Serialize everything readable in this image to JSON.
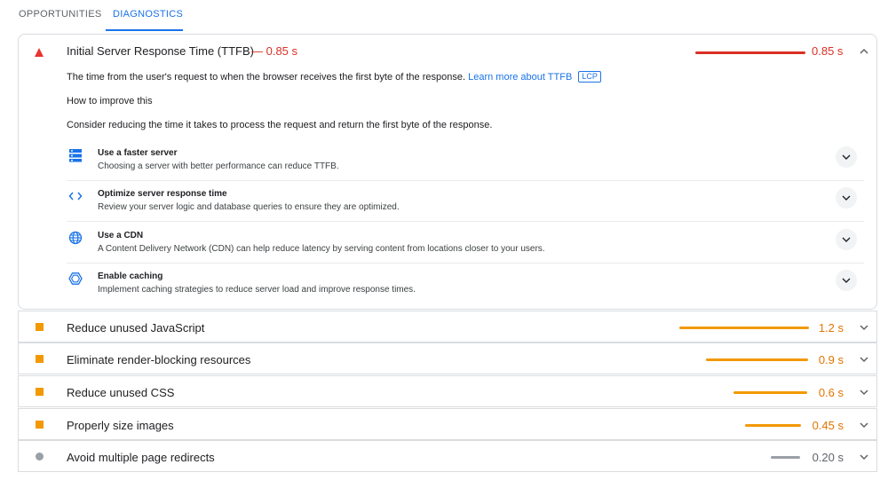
{
  "tabs": [
    {
      "label": "OPPORTUNITIES",
      "active": false
    },
    {
      "label": "DIAGNOSTICS",
      "active": true
    }
  ],
  "expanded": {
    "title": "Initial Server Response Time (TTFB)",
    "metric": "— 0.85 s",
    "value": "0.85 s",
    "description": "The time from the user's request to when the browser receives the first byte of the response.",
    "learn_more": "Learn more about TTFB",
    "badge": "LCP",
    "how_title": "How to improve this",
    "consider": "Consider reducing the time it takes to process the request and return the first byte of the response.",
    "suggestions": [
      {
        "icon": "server-icon",
        "title": "Use a faster server",
        "text": "Choosing a server with better performance can reduce TTFB."
      },
      {
        "icon": "code-icon",
        "title": "Optimize server response time",
        "text": "Review your server logic and database queries to ensure they are optimized."
      },
      {
        "icon": "globe-icon",
        "title": "Use a CDN",
        "text": "A Content Delivery Network (CDN) can help reduce latency by serving content from locations closer to your users."
      },
      {
        "icon": "hexagon-icon",
        "title": "Enable caching",
        "text": "Implement caching strategies to reduce server load and improve response times."
      }
    ]
  },
  "rows": [
    {
      "label": "Reduce unused JavaScript",
      "value": "1.2 s",
      "status": "average"
    },
    {
      "label": "Eliminate render-blocking resources",
      "value": "0.9 s",
      "status": "average"
    },
    {
      "label": "Reduce unused CSS",
      "value": "0.6 s",
      "status": "average"
    },
    {
      "label": "Properly size images",
      "value": "0.45 s",
      "status": "average"
    },
    {
      "label": "Avoid multiple page redirects",
      "value": "0.20 s",
      "status": "informative"
    }
  ],
  "colors": {
    "accent": "#1a73e8",
    "fail": "#d93025",
    "average": "#f29900",
    "informative": "#9aa0a6"
  }
}
